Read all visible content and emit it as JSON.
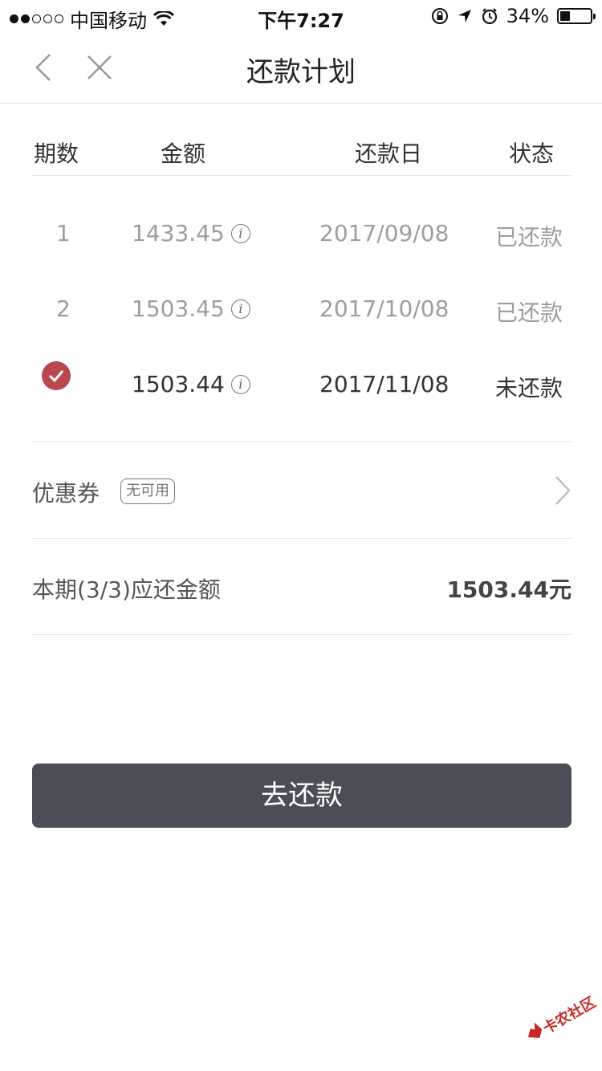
{
  "status_bar": {
    "carrier": "中国移动",
    "time": "下午7:27",
    "battery": "34%",
    "battery_level": 0.34,
    "signal_bars": 2
  },
  "nav": {
    "title": "还款计划",
    "back_icon": "chevron-left-icon",
    "close_icon": "close-icon"
  },
  "table": {
    "headers": {
      "period": "期数",
      "amount": "金额",
      "date": "还款日",
      "status": "状态"
    },
    "rows": [
      {
        "period": "1",
        "amount": "1433.45",
        "date": "2017/09/08",
        "status": "已还款",
        "selected": false
      },
      {
        "period": "2",
        "amount": "1503.45",
        "date": "2017/10/08",
        "status": "已还款",
        "selected": false
      },
      {
        "period": "",
        "amount": "1503.44",
        "date": "2017/11/08",
        "status": "未还款",
        "selected": true
      }
    ],
    "info_glyph": "i"
  },
  "coupon": {
    "label": "优惠券",
    "badge": "无可用"
  },
  "due": {
    "label": "本期(3/3)应还金额",
    "value": "1503.44元"
  },
  "pay_button": {
    "label": "去还款"
  },
  "watermark": {
    "text": "卡农社区"
  },
  "colors": {
    "accent": "#b8474f",
    "button": "#4a4e56"
  }
}
